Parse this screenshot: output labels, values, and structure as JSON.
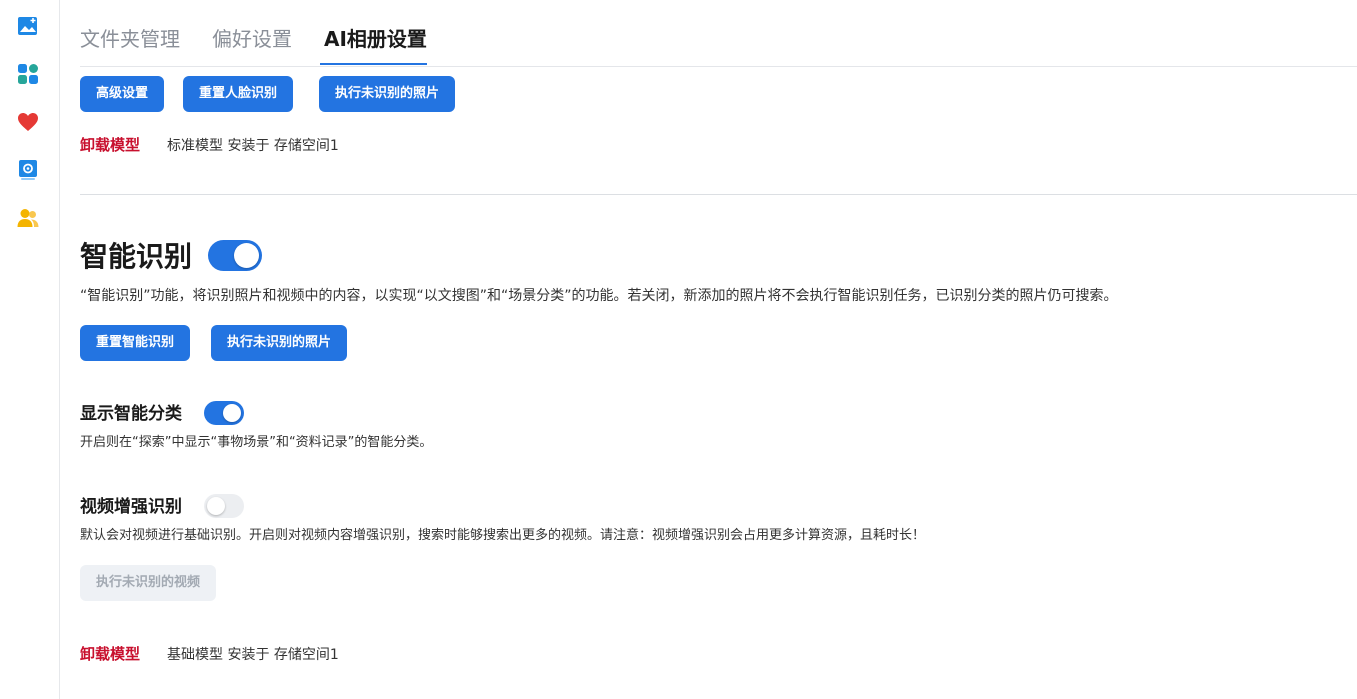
{
  "colors": {
    "accent": "#2374e1",
    "danger": "#c8102e"
  },
  "sidebar": {
    "items": [
      {
        "icon": "image-add-icon",
        "color": "#1e88e5"
      },
      {
        "icon": "apps-grid-icon",
        "color": "#26a69a"
      },
      {
        "icon": "heart-icon",
        "color": "#e53935"
      },
      {
        "icon": "photo-settings-icon",
        "color": "#1e88e5"
      },
      {
        "icon": "people-icon",
        "color": "#f4b400"
      }
    ]
  },
  "tabs": [
    {
      "label": "文件夹管理",
      "active": false
    },
    {
      "label": "偏好设置",
      "active": false
    },
    {
      "label": "AI相册设置",
      "active": true
    }
  ],
  "face_section": {
    "buttons": [
      "高级设置",
      "重置人脸识别",
      "执行未识别的照片"
    ],
    "uninstall_label": "卸载模型",
    "model_info": "标准模型 安装于 存储空间1"
  },
  "smart_section": {
    "title": "智能识别",
    "enabled": true,
    "description": "“智能识别”功能，将识别照片和视频中的内容，以实现“以文搜图”和“场景分类”的功能。若关闭，新添加的照片将不会执行智能识别任务，已识别分类的照片仍可搜索。",
    "buttons": [
      "重置智能识别",
      "执行未识别的照片"
    ],
    "show_category": {
      "title": "显示智能分类",
      "enabled": true,
      "description": "开启则在“探索”中显示“事物场景”和“资料记录”的智能分类。"
    },
    "video_enhance": {
      "title": "视频增强识别",
      "enabled": false,
      "description": "默认会对视频进行基础识别。开启则对视频内容增强识别，搜索时能够搜索出更多的视频。请注意：视频增强识别会占用更多计算资源，且耗时长！",
      "button": "执行未识别的视频"
    },
    "uninstall_label": "卸载模型",
    "model_info": "基础模型 安装于 存储空间1"
  }
}
